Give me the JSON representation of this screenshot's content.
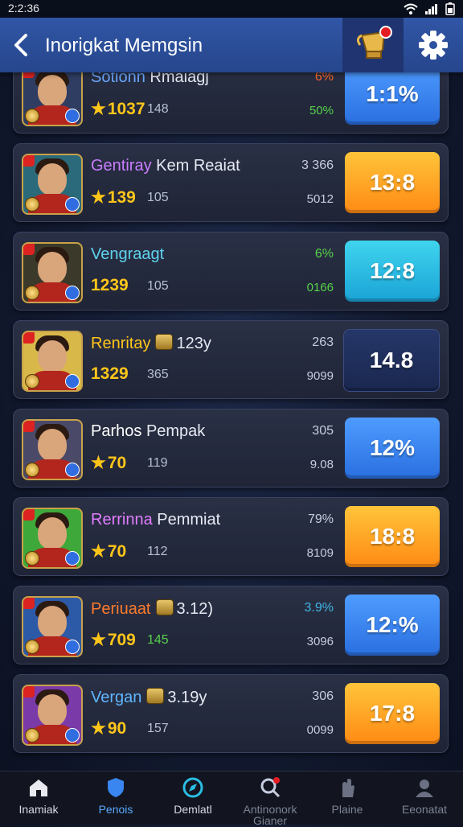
{
  "status_bar": {
    "time": "2:2:36"
  },
  "header": {
    "title": "Inorigkat Memgsin"
  },
  "rows": [
    {
      "name": "Sotionn",
      "name_extra": "Rmaiagj",
      "name_color": "#6aa8ff",
      "score": "1037",
      "score_star": true,
      "minor": "148",
      "minor_color": "#b8bfd4",
      "stat_top": "6%",
      "stat_top_color": "#ff6a2b",
      "stat_bot": "50%",
      "stat_bot_color": "#56d24a",
      "value": "1:1%",
      "value_style": "blue",
      "avatar_bg": "#2f3d62"
    },
    {
      "name": "Gentiray",
      "name_extra": "Kem Reaiat",
      "name_color": "#c97dff",
      "score": "139",
      "score_star": true,
      "minor": "105",
      "minor_color": "#b8bfd4",
      "stat_top": "3 366",
      "stat_top_color": "#c7cce0",
      "stat_bot": "5012",
      "stat_bot_color": "#c7cce0",
      "value": "13:8",
      "value_style": "orange",
      "avatar_bg": "#2b6a7a"
    },
    {
      "name": "Vengraagt",
      "name_extra": "",
      "name_color": "#5fd3ee",
      "score": "1239",
      "score_star": false,
      "minor": "105",
      "minor_color": "#b8bfd4",
      "stat_top": "6%",
      "stat_top_color": "#56d24a",
      "stat_bot": "0166",
      "stat_bot_color": "#56d24a",
      "value": "12:8",
      "value_style": "cyan",
      "avatar_bg": "#3b3a2a"
    },
    {
      "name": "Renritay",
      "name_extra": "123y",
      "name_color": "#ffc61a",
      "chest": true,
      "score": "1329",
      "score_star": false,
      "minor": "365",
      "minor_color": "#b8bfd4",
      "stat_top": "263",
      "stat_top_color": "#c7cce0",
      "stat_bot": "9099",
      "stat_bot_color": "#c7cce0",
      "value": "14.8",
      "value_style": "navy",
      "avatar_bg": "#d9b84a"
    },
    {
      "name": "Parhos",
      "name_extra": "Pempak",
      "name_color": "#ffffff",
      "score": "70",
      "score_star": true,
      "minor": "119",
      "minor_color": "#b8bfd4",
      "stat_top": "305",
      "stat_top_color": "#c7cce0",
      "stat_bot": "9.08",
      "stat_bot_color": "#c7cce0",
      "value": "12%",
      "value_style": "blue",
      "avatar_bg": "#4a4a68"
    },
    {
      "name": "Rerrinna",
      "name_extra": "Pemmiat",
      "name_color": "#e07dff",
      "score": "70",
      "score_star": true,
      "minor": "112",
      "minor_color": "#b8bfd4",
      "stat_top": "79%",
      "stat_top_color": "#c7cce0",
      "stat_bot": "8109",
      "stat_bot_color": "#c7cce0",
      "value": "18:8",
      "value_style": "orange",
      "avatar_bg": "#3ea83a"
    },
    {
      "name": "Periuaat",
      "name_extra": "3.12)",
      "name_color": "#ff7a2b",
      "chest": true,
      "score": "709",
      "score_star": true,
      "minor": "145",
      "minor_color": "#56d24a",
      "stat_top": "3.9%",
      "stat_top_color": "#3fb6e6",
      "stat_bot": "3096",
      "stat_bot_color": "#c7cce0",
      "value": "12:%",
      "value_style": "blue",
      "avatar_bg": "#2d5aa6"
    },
    {
      "name": "Vergan",
      "name_extra": "3.19y",
      "name_color": "#5fb6ff",
      "chest": true,
      "score": "90",
      "score_star": true,
      "minor": "157",
      "minor_color": "#b8bfd4",
      "stat_top": "306",
      "stat_top_color": "#c7cce0",
      "stat_bot": "0099",
      "stat_bot_color": "#c7cce0",
      "value": "17:8",
      "value_style": "orange",
      "avatar_bg": "#7a3aa8"
    }
  ],
  "bottom_nav": [
    {
      "label": "Inamiak",
      "icon": "home-icon",
      "state": "normal"
    },
    {
      "label": "Penois",
      "icon": "shield-icon",
      "state": "active"
    },
    {
      "label": "Demlatl",
      "icon": "compass-icon",
      "state": "normal"
    },
    {
      "label": "Antinonork Gianer",
      "icon": "search-icon",
      "state": "muted"
    },
    {
      "label": "Plaine",
      "icon": "hand-icon",
      "state": "muted"
    },
    {
      "label": "Eeonatat",
      "icon": "profile-icon",
      "state": "muted"
    }
  ],
  "colors": {
    "header": "#2d50a0",
    "accent_blue": "#3a86f0",
    "accent_orange": "#ffa326",
    "accent_cyan": "#2bbde3",
    "gold": "#ffc61a"
  }
}
